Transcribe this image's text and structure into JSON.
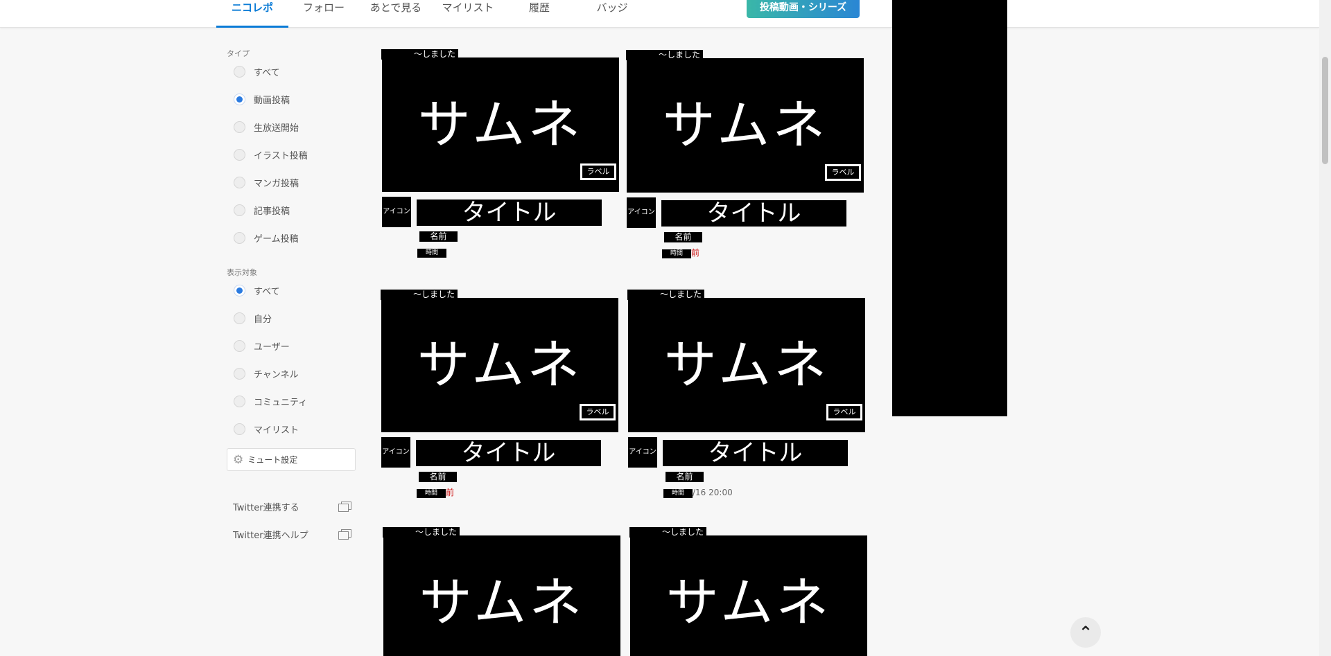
{
  "nav": {
    "tabs": [
      {
        "label": "ニコレポ"
      },
      {
        "label": "フォロー"
      },
      {
        "label": "あとで見る"
      },
      {
        "label": "マイリスト"
      },
      {
        "label": "履歴"
      },
      {
        "label": "バッジ"
      }
    ],
    "post_button": "投稿動画・シリーズ"
  },
  "sidebar": {
    "type_label": "タイプ",
    "type_options": [
      {
        "label": "すべて",
        "checked": false
      },
      {
        "label": "動画投稿",
        "checked": true
      },
      {
        "label": "生放送開始",
        "checked": false
      },
      {
        "label": "イラスト投稿",
        "checked": false
      },
      {
        "label": "マンガ投稿",
        "checked": false
      },
      {
        "label": "記事投稿",
        "checked": false
      },
      {
        "label": "ゲーム投稿",
        "checked": false
      }
    ],
    "target_label": "表示対象",
    "target_options": [
      {
        "label": "すべて",
        "checked": true
      },
      {
        "label": "自分",
        "checked": false
      },
      {
        "label": "ユーザー",
        "checked": false
      },
      {
        "label": "チャンネル",
        "checked": false
      },
      {
        "label": "コミュニティ",
        "checked": false
      },
      {
        "label": "マイリスト",
        "checked": false
      }
    ],
    "mute_button": "ミュート設定",
    "twitter_link": "Twitter連携する",
    "twitter_help": "Twitter連携ヘルプ"
  },
  "cards": [
    {
      "did": "〜しました",
      "thumb": "サムネ",
      "label": "ラベル",
      "icon": "アイコン",
      "title": "タイトル",
      "name": "名前",
      "time": "時間",
      "extra": ""
    },
    {
      "did": "〜しました",
      "thumb": "サムネ",
      "label": "ラベル",
      "icon": "アイコン",
      "title": "タイトル",
      "name": "名前",
      "time": "時間",
      "extra": "前"
    },
    {
      "did": "〜しました",
      "thumb": "サムネ",
      "label": "ラベル",
      "icon": "アイコン",
      "title": "タイトル",
      "name": "名前",
      "time": "時間",
      "extra": "前"
    },
    {
      "did": "〜しました",
      "thumb": "サムネ",
      "label": "ラベル",
      "icon": "アイコン",
      "title": "タイトル",
      "name": "名前",
      "time": "時間",
      "extra": "/16 20:00"
    },
    {
      "did": "〜しました",
      "thumb": "サムネ"
    },
    {
      "did": "〜しました",
      "thumb": "サムネ"
    }
  ],
  "back_to_top": "⌃"
}
